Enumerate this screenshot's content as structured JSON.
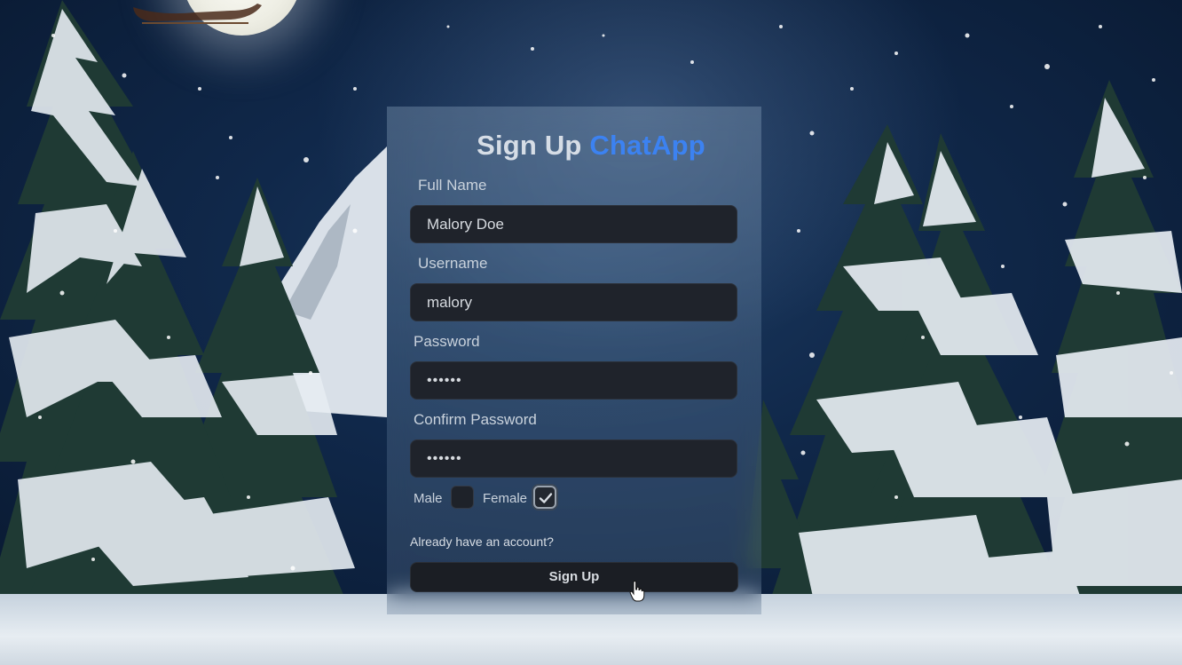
{
  "form": {
    "title": "Sign Up",
    "brand": "ChatApp",
    "fullname_label": "Full Name",
    "fullname_value": "Malory Doe",
    "username_label": "Username",
    "username_value": "malory",
    "password_label": "Password",
    "password_value": "••••••",
    "confirm_label": "Confirm Password",
    "confirm_value": "••••••",
    "gender_male_label": "Male",
    "gender_female_label": "Female",
    "gender_male_checked": false,
    "gender_female_checked": true,
    "login_link": "Already have an account?",
    "submit_label": "Sign Up"
  },
  "colors": {
    "brand": "#3c82f1",
    "input_bg": "#1f232b",
    "button_bg": "#1b1e24"
  },
  "icons": {
    "checkmark": "check-icon",
    "cursor": "hand-pointer-icon"
  }
}
